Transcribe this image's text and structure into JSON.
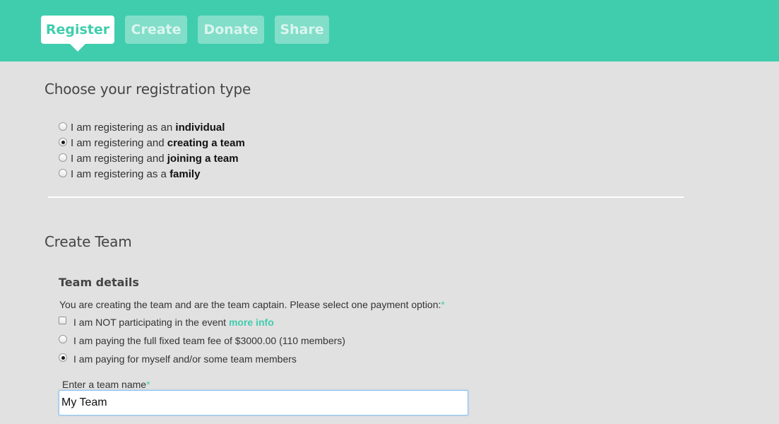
{
  "nav": {
    "tabs": [
      {
        "label": "Register",
        "active": true
      },
      {
        "label": "Create",
        "active": false
      },
      {
        "label": "Donate",
        "active": false
      },
      {
        "label": "Share",
        "active": false
      }
    ]
  },
  "registration": {
    "title": "Choose your registration type",
    "options": [
      {
        "prefix": "I am registering as an ",
        "bold": "individual",
        "selected": false
      },
      {
        "prefix": "I am registering and ",
        "bold": "creating a team",
        "selected": true
      },
      {
        "prefix": "I am registering and ",
        "bold": "joining a team",
        "selected": false
      },
      {
        "prefix": "I am registering as a ",
        "bold": "family",
        "selected": false
      }
    ]
  },
  "create_team": {
    "title": "Create Team",
    "details_title": "Team details",
    "instruction": "You are creating the team and are the team captain. Please select one payment option:",
    "required_mark": "*",
    "payment_options": [
      {
        "text": "I am NOT participating in the event ",
        "link": "more info",
        "type": "checkbox",
        "checked": false
      },
      {
        "text": "I am paying the full fixed team fee of $3000.00 (110 members)",
        "type": "radio",
        "checked": false
      },
      {
        "text": "I am paying for myself and/or some team members",
        "type": "radio",
        "checked": true
      }
    ],
    "team_name_label": "Enter a team name",
    "team_name_value": "My Team"
  },
  "colors": {
    "accent": "#40cdad",
    "background": "#e1e1e1"
  }
}
